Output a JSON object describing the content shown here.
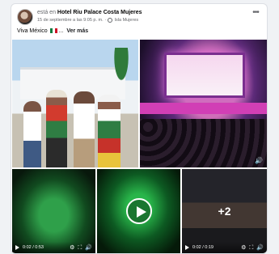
{
  "post": {
    "status_text": "está en",
    "place": "Hotel Riu Palace Costa Mujeres",
    "timestamp": "15 de septiembre a las 9:05 p. m.",
    "location": "Isla Mujeres",
    "separator": "·",
    "more_glyph": "•••"
  },
  "caption": {
    "text": "Viva México",
    "see_more": "Ver más"
  },
  "media": {
    "video_1": {
      "time": "0:02 / 0:53"
    },
    "video_3": {
      "time": "0:02 / 0:19",
      "extra_count": "+2"
    }
  },
  "icons": {
    "play": "play-icon",
    "settings": "gear-icon",
    "fullscreen": "fullscreen-icon",
    "volume": "volume-icon",
    "privacy": "globe-icon"
  },
  "colors": {
    "background": "#f0f2f5",
    "card": "#ffffff",
    "secondary_text": "#65676b"
  }
}
